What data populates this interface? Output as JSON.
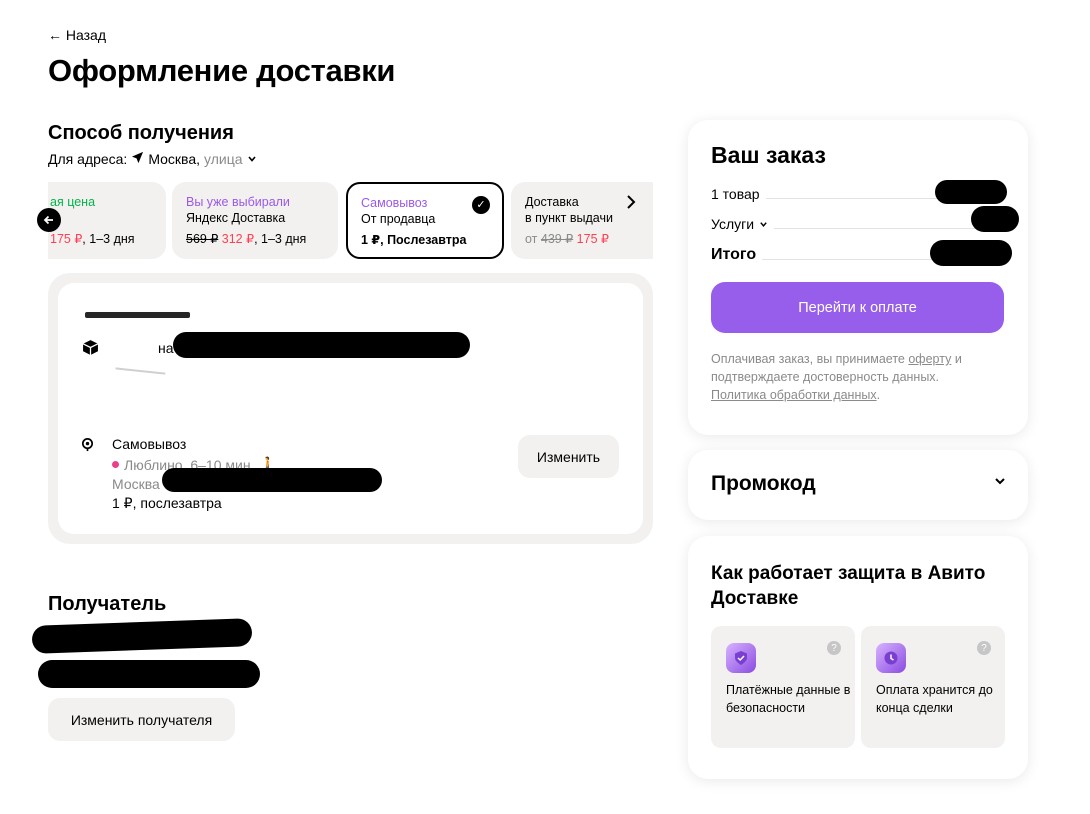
{
  "header": {
    "back_label": "← Назад",
    "title": "Оформление доставки"
  },
  "delivery_method": {
    "heading": "Способ получения",
    "address_prefix": "Для адреса:",
    "address_city": "Москва,",
    "address_street": "улица",
    "options": [
      {
        "line1": "ая цена",
        "price_new": "175 ₽",
        "line3_suffix": ", 1–3 дня"
      },
      {
        "line1": "Вы уже выбирали",
        "line2": "Яндекс Доставка",
        "price_old": "569 ₽",
        "price_new": "312 ₽",
        "line3_suffix": ", 1–3 дня"
      },
      {
        "line1": "Самовывоз",
        "line2": "От продавца",
        "line3": "1 ₽, Послезавтра",
        "selected": true
      },
      {
        "line1": "Доставка",
        "line2": "в пункт выдачи",
        "price_prefix": "от",
        "price_old": "439 ₽",
        "price_new": "175 ₽"
      }
    ]
  },
  "pickup": {
    "package_text": "на",
    "title": "Самовывоз",
    "metro": "Люблино, 6–10 мин.",
    "city": "Москва",
    "price": "1 ₽, послезавтра",
    "change_label": "Изменить"
  },
  "recipient": {
    "heading": "Получатель",
    "change_label": "Изменить получателя"
  },
  "order": {
    "title": "Ваш заказ",
    "items_label": "1 товар",
    "services_label": "Услуги",
    "total_label": "Итого",
    "pay_label": "Перейти к оплате",
    "legal_1": "Оплачивая заказ, вы принимаете",
    "legal_offer": "оферту",
    "legal_2": "и подтверждаете достоверность данных.",
    "legal_policy": "Политика обработки данных",
    "legal_end": "."
  },
  "promo": {
    "title": "Промокод"
  },
  "protection": {
    "title": "Как работает защита в Авито Доставке",
    "tiles": [
      {
        "text": "Платёжные данные в безопасности",
        "icon": "shield-check-icon"
      },
      {
        "text": "Оплата хранится до конца сделки",
        "icon": "clock-icon"
      }
    ]
  },
  "colors": {
    "accent": "#965eeb",
    "sale_red": "#ff4053",
    "green": "#04b34a",
    "metro_dot": "#e8418b"
  }
}
